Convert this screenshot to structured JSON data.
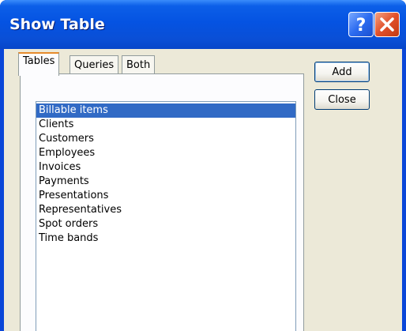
{
  "window": {
    "title": "Show Table",
    "help_glyph": "?",
    "close_glyph": "✕"
  },
  "tabs": [
    {
      "label": "Tables",
      "active": true
    },
    {
      "label": "Queries",
      "active": false
    },
    {
      "label": "Both",
      "active": false
    }
  ],
  "tables_list": {
    "selected_index": 0,
    "items": [
      "Billable items",
      "Clients",
      "Customers",
      "Employees",
      "Invoices",
      "Payments",
      "Presentations",
      "Representatives",
      "Spot orders",
      "Time bands"
    ]
  },
  "buttons": {
    "add_label": "Add",
    "close_label": "Close"
  },
  "colors": {
    "titlebar": "#0553e2",
    "selection": "#316ac5",
    "dialog_face": "#ece9d8",
    "active_tab_accent": "#e68b2c"
  }
}
